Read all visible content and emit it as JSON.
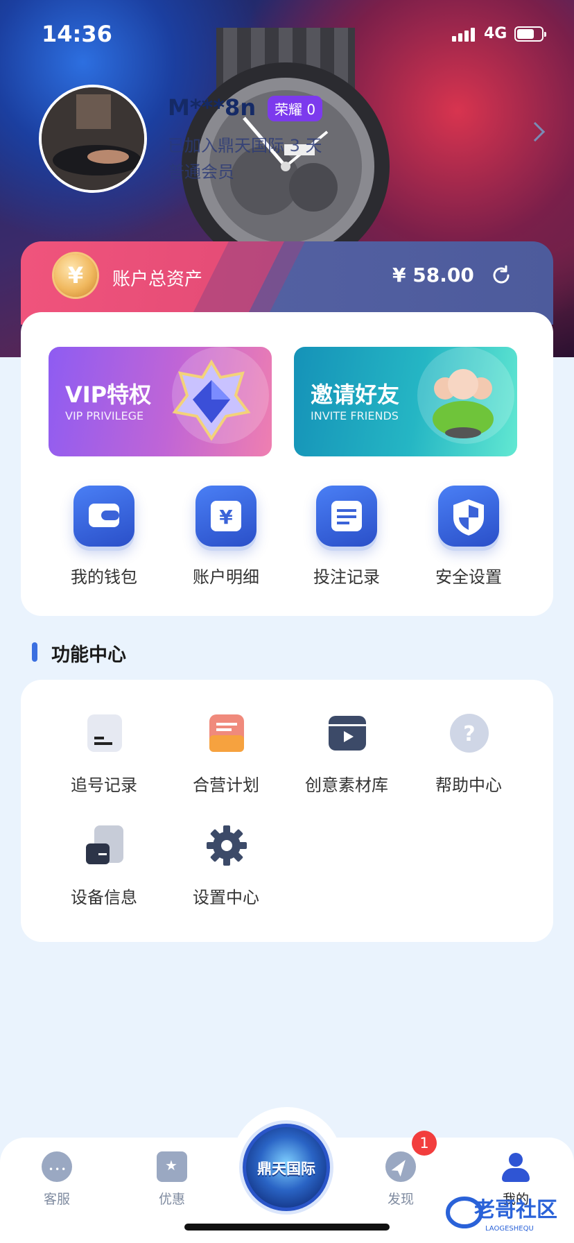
{
  "status_bar": {
    "time": "14:36",
    "network": "4G",
    "battery_pct": 70
  },
  "profile": {
    "username": "M***8n",
    "honor_badge": "荣耀 0",
    "line1": "已加入鼎天国际 3 天",
    "line2": "普通会员"
  },
  "assets": {
    "label": "账户总资产",
    "currency": "¥",
    "amount": "58.00",
    "coin_symbol": "¥"
  },
  "banners": [
    {
      "title": "VIP特权",
      "subtitle": "VIP PRIVILEGE"
    },
    {
      "title": "邀请好友",
      "subtitle": "INVITE FRIENDS"
    }
  ],
  "quick_actions": [
    {
      "label": "我的钱包",
      "icon": "wallet-icon"
    },
    {
      "label": "账户明细",
      "icon": "yuan-icon"
    },
    {
      "label": "投注记录",
      "icon": "record-icon"
    },
    {
      "label": "安全设置",
      "icon": "shield-icon"
    }
  ],
  "function_center": {
    "title": "功能中心",
    "items": [
      {
        "label": "追号记录",
        "icon": "chase-record-icon"
      },
      {
        "label": "合营计划",
        "icon": "partner-plan-icon"
      },
      {
        "label": "创意素材库",
        "icon": "creative-library-icon"
      },
      {
        "label": "帮助中心",
        "icon": "help-icon"
      },
      {
        "label": "设备信息",
        "icon": "device-icon"
      },
      {
        "label": "设置中心",
        "icon": "gear-icon"
      }
    ]
  },
  "tabbar": {
    "items": [
      {
        "label": "客服",
        "icon": "chat-icon"
      },
      {
        "label": "优惠",
        "icon": "ticket-icon"
      },
      {
        "label": "发现",
        "icon": "compass-icon"
      },
      {
        "label": "我的",
        "icon": "user-icon"
      }
    ],
    "center_logo": "鼎天国际",
    "discover_badge": "1"
  },
  "watermark": {
    "text": "老哥社区",
    "subtext": "LAOGESHEQU"
  },
  "colors": {
    "accent": "#3b6fe0",
    "badge": "#f23d3d",
    "honor": "#7c3aed",
    "bg": "#eaf3fd"
  }
}
